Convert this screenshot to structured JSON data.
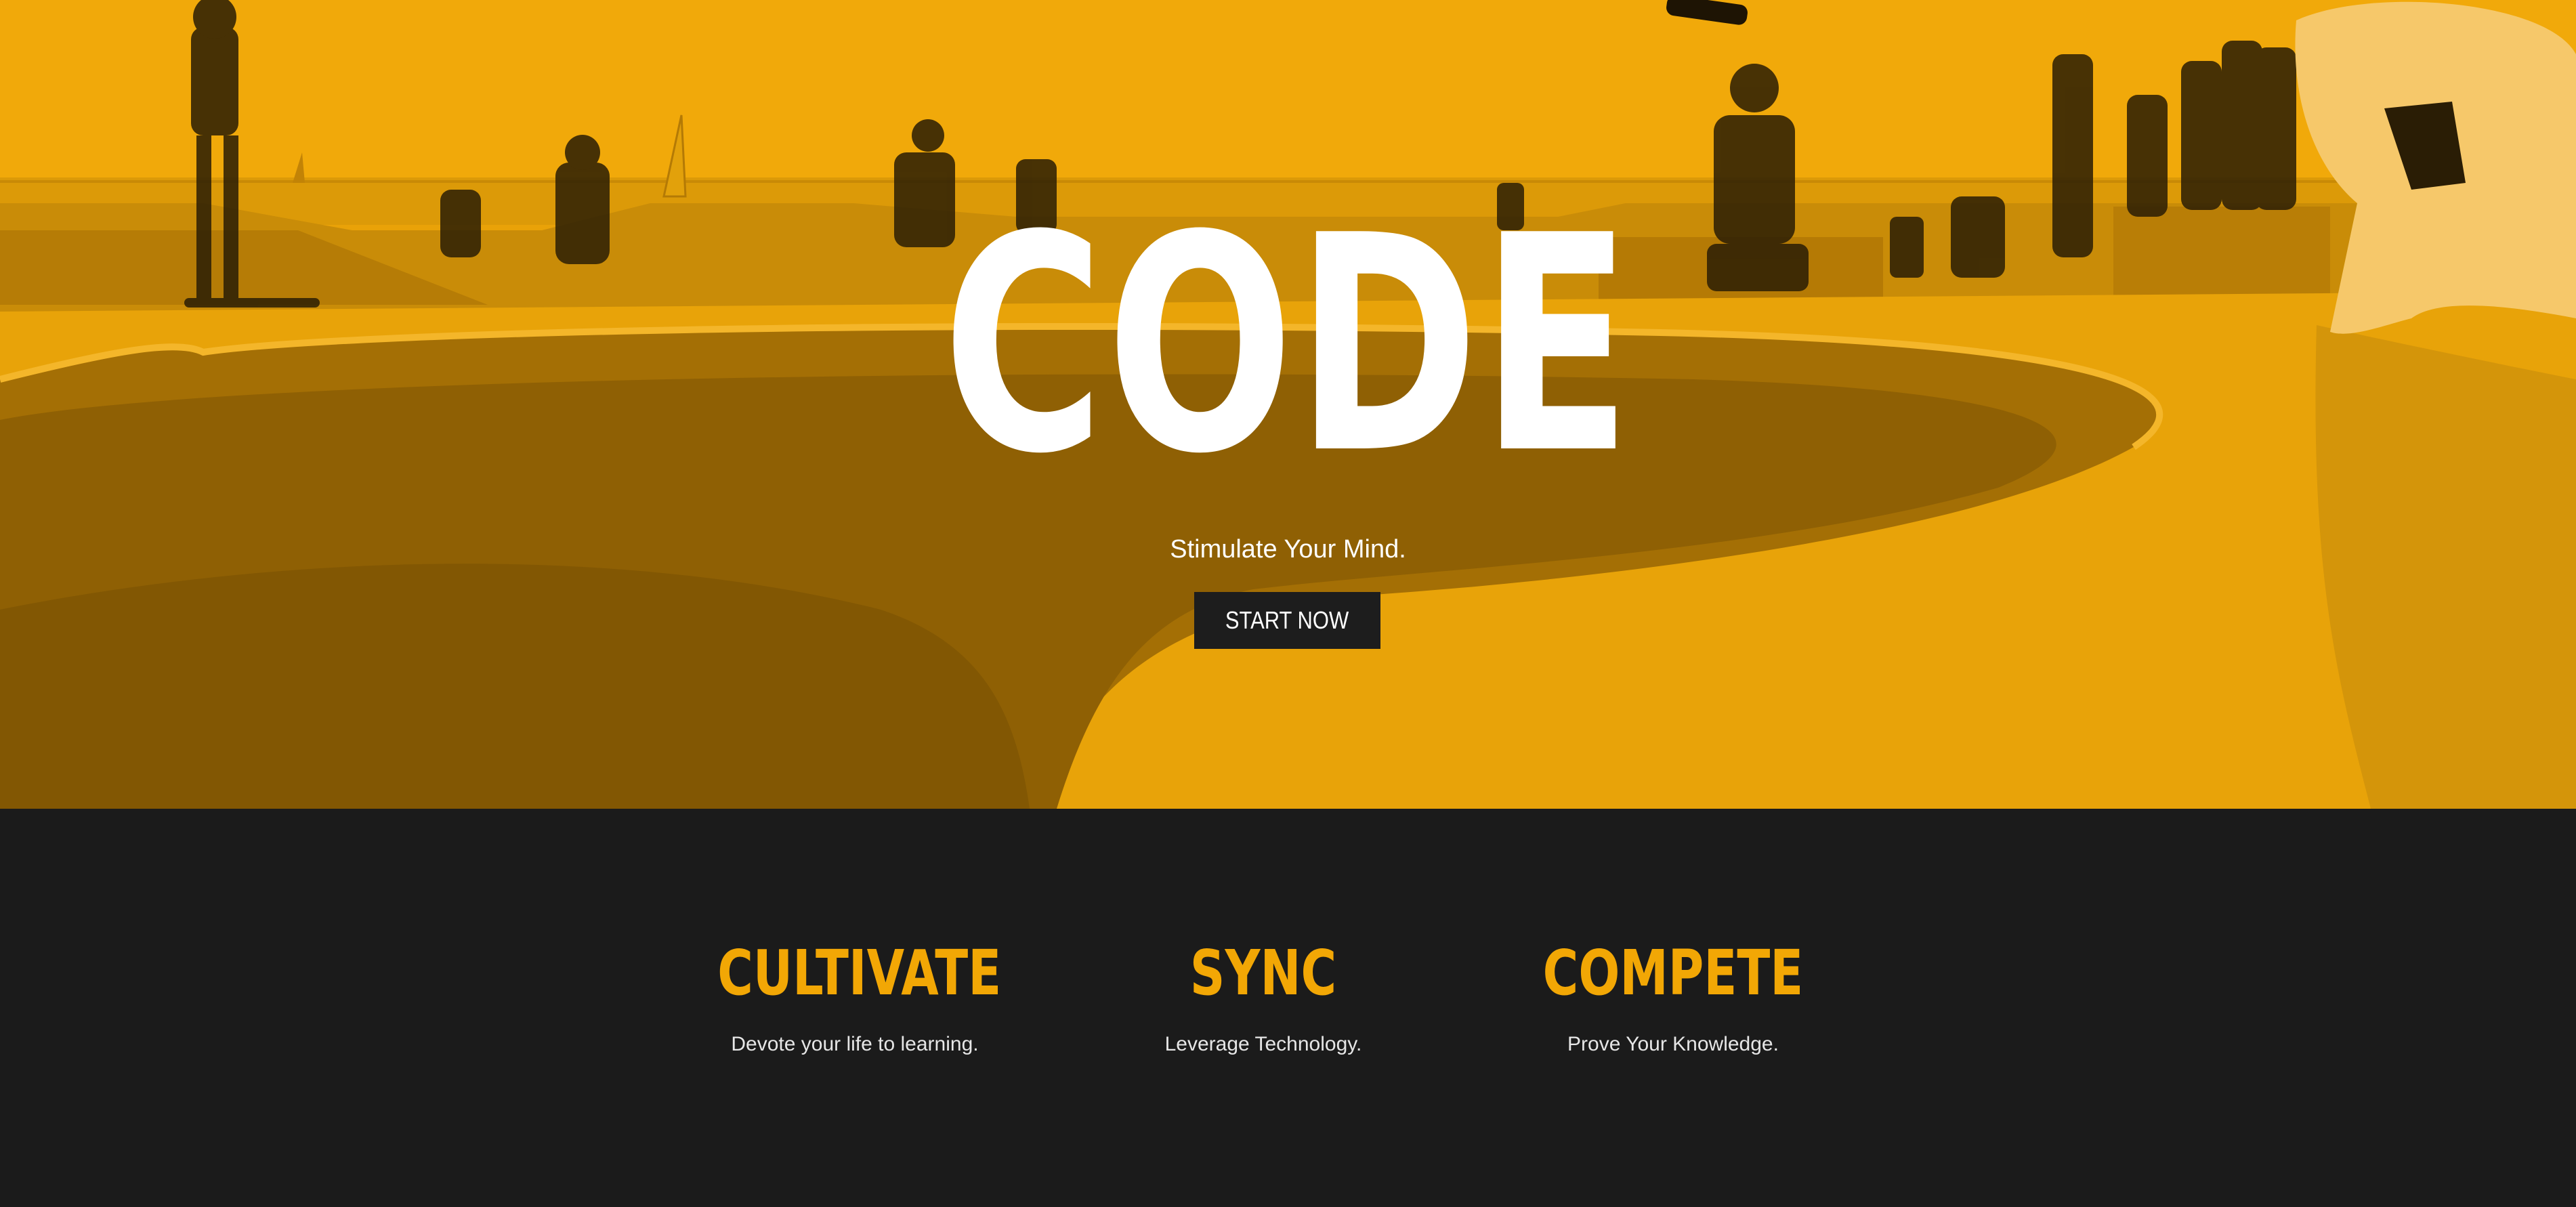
{
  "hero": {
    "title": "CODE",
    "tagline": "Stimulate Your Mind.",
    "cta_label": "START NOW",
    "background_image": "skatepark-photo-with-orange-duotone"
  },
  "features": [
    {
      "heading": "CULTIVATE",
      "text": "Devote your life to learning."
    },
    {
      "heading": "SYNC",
      "text": "Leverage Technology."
    },
    {
      "heading": "COMPETE",
      "text": "Prove Your Knowledge."
    }
  ],
  "colors": {
    "hero_overlay": "#e9a208",
    "dark_background": "#1b1b1b",
    "accent": "#f2a705",
    "button_background": "#1d1d1d",
    "text_light": "#ffffff"
  }
}
